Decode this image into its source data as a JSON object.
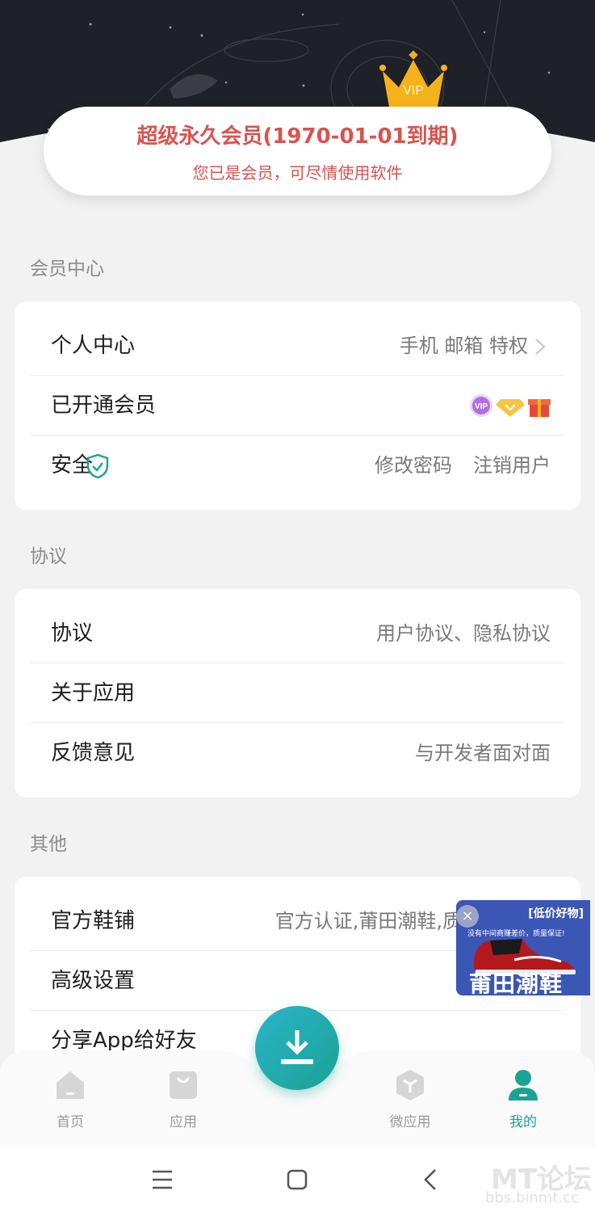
{
  "header": {
    "vip_title": "超级永久会员(1970-01-01到期)",
    "vip_subtitle": "您已是会员，可尽情使用软件",
    "crown_text": "VIP"
  },
  "sections": {
    "member": {
      "title": "会员中心",
      "rows": [
        {
          "label": "个人中心",
          "value": "手机 邮箱 特权"
        },
        {
          "label": "已开通会员",
          "value": ""
        },
        {
          "label": "安全",
          "value_1": "修改密码",
          "value_2": "注销用户"
        }
      ]
    },
    "agreement": {
      "title": "协议",
      "rows": [
        {
          "label": "协议",
          "value": "用户协议、隐私协议"
        },
        {
          "label": "关于应用",
          "value": ""
        },
        {
          "label": "反馈意见",
          "value": "与开发者面对面"
        }
      ]
    },
    "other": {
      "title": "其他",
      "rows": [
        {
          "label": "官方鞋铺",
          "value": "官方认证,莆田潮鞋,质"
        },
        {
          "label": "高级设置",
          "value": ""
        },
        {
          "label": "分享App给好友",
          "value": ""
        }
      ]
    }
  },
  "ad": {
    "tag": "[低价好物]",
    "line": "没有中间商赚差价，质量保证!",
    "title": "莆田潮鞋",
    "close": "×"
  },
  "bottom_nav": {
    "items": [
      {
        "label": "首页",
        "icon": "home-icon"
      },
      {
        "label": "应用",
        "icon": "bag-icon"
      },
      {
        "label": "微应用",
        "icon": "cube-icon"
      },
      {
        "label": "我的",
        "icon": "user-icon"
      }
    ],
    "active": "我的",
    "fab_icon": "download-icon"
  },
  "watermark": {
    "brand": "MT论坛",
    "url": "bbs.binmt.cc"
  },
  "colors": {
    "accent": "#1aa394",
    "vip_red": "#d9534f",
    "header_dark": "#1f2128",
    "background": "#f2f2f2"
  }
}
